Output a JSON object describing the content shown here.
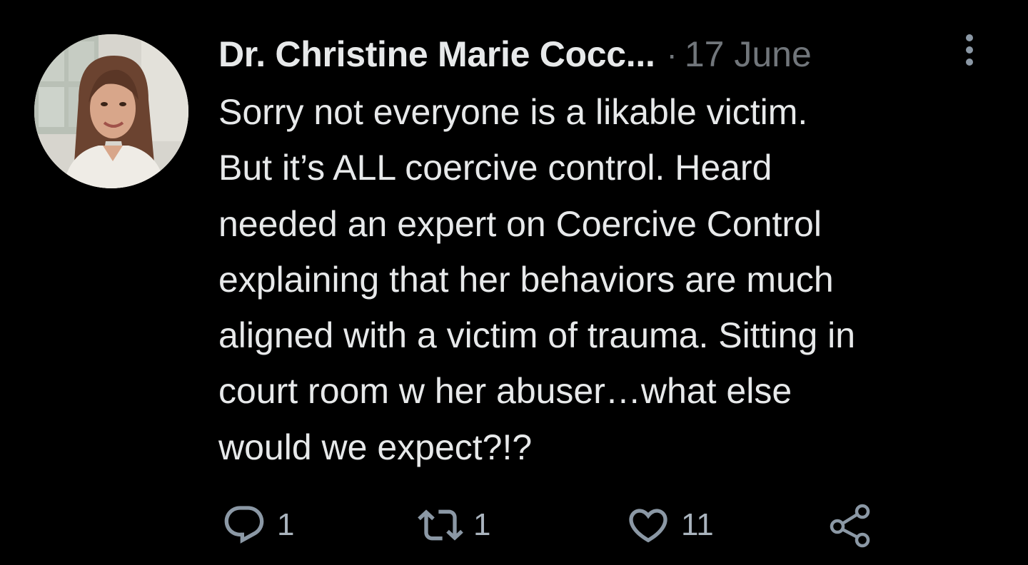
{
  "tweet": {
    "author_name": "Dr. Christine Marie Cocc...",
    "separator": "·",
    "timestamp": "17 June",
    "text": "Sorry not everyone is a likable victim.\nBut it’s ALL coercive control. Heard\nneeded an expert on Coercive Control\nexplaining that her behaviors are much\naligned with a victim of trauma. Sitting in\ncourt room w her abuser…what else\nwould we expect?!?",
    "actions": {
      "reply_count": "1",
      "retweet_count": "1",
      "like_count": "11"
    }
  },
  "icons": {
    "avatar": "profile-photo",
    "more": "more-vertical-icon",
    "reply": "reply-icon",
    "retweet": "retweet-icon",
    "like": "heart-icon",
    "share": "share-icon"
  },
  "colors": {
    "background": "#000000",
    "text_primary": "#e7e9ea",
    "text_secondary": "#71767b",
    "icon": "#8b98a5"
  }
}
